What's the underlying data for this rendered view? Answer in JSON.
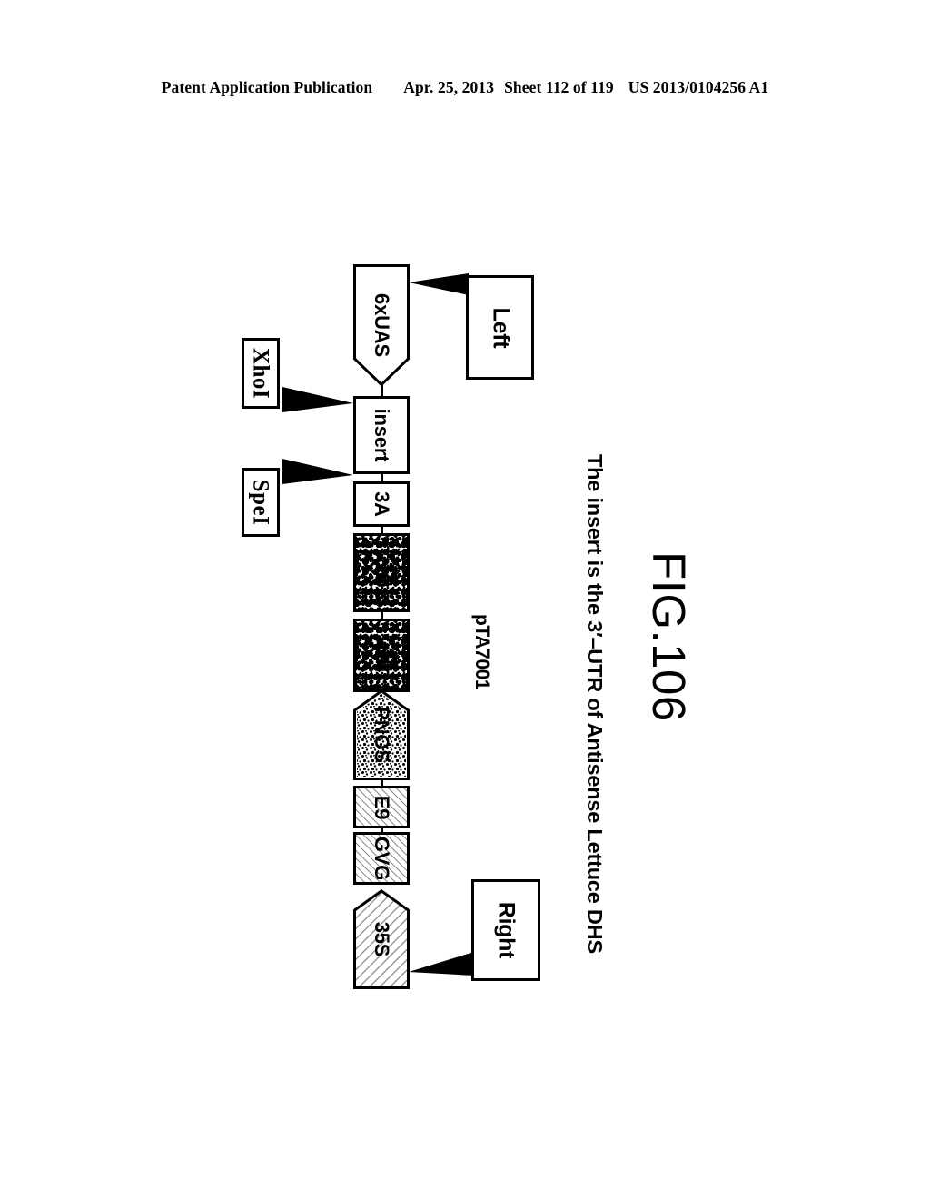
{
  "header": {
    "publication": "Patent Application Publication",
    "date": "Apr. 25, 2013",
    "sheet": "Sheet 112 of 119",
    "patent_number": "US 2013/0104256 A1"
  },
  "figure": {
    "number": "FIG.106",
    "plasmid_name": "pTA7001",
    "note": "The insert is the 3′–UTR of Antisense Lettuce DHS",
    "border_labels": {
      "left": "Left",
      "right": "Right"
    },
    "restriction_sites": [
      {
        "name": "XhoI",
        "target": "insert"
      },
      {
        "name": "SpeI",
        "target": "insert"
      }
    ],
    "map_elements": [
      {
        "id": "6xuas",
        "label": "6xUAS",
        "shape": "arrow",
        "fill": "none"
      },
      {
        "id": "insert",
        "label": "insert",
        "shape": "rectangle",
        "fill": "none"
      },
      {
        "id": "3a",
        "label": "3A",
        "shape": "rectangle",
        "fill": "none"
      },
      {
        "id": "tnos",
        "label": "TNOS",
        "shape": "rectangle",
        "fill": "speckle"
      },
      {
        "id": "hpt",
        "label": "HPT",
        "shape": "rectangle",
        "fill": "speckle"
      },
      {
        "id": "pnos",
        "label": "PNOS",
        "shape": "arrow",
        "fill": "speckle"
      },
      {
        "id": "e9",
        "label": "E9",
        "shape": "rectangle",
        "fill": "hatch"
      },
      {
        "id": "gvg",
        "label": "GVG",
        "shape": "rectangle",
        "fill": "hatch"
      },
      {
        "id": "35s",
        "label": "35S",
        "shape": "arrow",
        "fill": "hatch"
      }
    ],
    "colors": {
      "stroke": "#000000",
      "background": "#ffffff",
      "hatch": "#8d8d8d"
    }
  }
}
